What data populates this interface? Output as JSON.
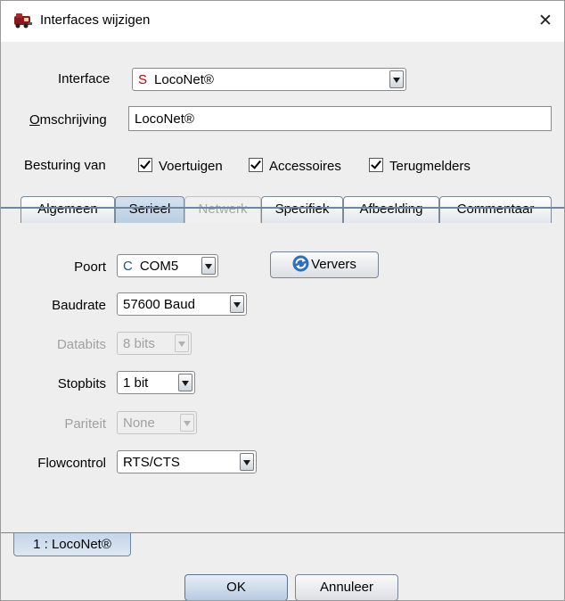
{
  "window": {
    "title": "Interfaces wijzigen",
    "close_symbol": "✕"
  },
  "interface": {
    "label": "Interface",
    "badge": "S",
    "value": "LocoNet®"
  },
  "description": {
    "label_first": "O",
    "label_rest": "mschrijving",
    "value": "LocoNet®"
  },
  "control": {
    "label": "Besturing van",
    "options": [
      {
        "label": "Voertuigen",
        "checked": true
      },
      {
        "label": "Accessoires",
        "checked": true
      },
      {
        "label": "Terugmelders",
        "checked": true
      }
    ]
  },
  "tabs": [
    {
      "label": "Algemeen",
      "state": "normal"
    },
    {
      "label": "Serieel",
      "state": "selected"
    },
    {
      "label": "Netwerk",
      "state": "disabled"
    },
    {
      "label": "Specifiek",
      "state": "normal"
    },
    {
      "label": "Afbeelding",
      "state": "normal"
    },
    {
      "label": "Commentaar",
      "state": "normal"
    }
  ],
  "serial": {
    "port": {
      "label": "Poort",
      "badge": "C",
      "value": "COM5"
    },
    "refresh_label": "Ververs",
    "baudrate": {
      "label": "Baudrate",
      "value": "57600 Baud"
    },
    "databits": {
      "label": "Databits",
      "value": "8 bits",
      "enabled": false
    },
    "stopbits": {
      "label": "Stopbits",
      "value": "1 bit"
    },
    "parity": {
      "label": "Pariteit",
      "value": "None",
      "enabled": false
    },
    "flowcontrol": {
      "label": "Flowcontrol",
      "value": "RTS/CTS"
    }
  },
  "interface_list": {
    "tab_label": "1 : LocoNet®"
  },
  "buttons": {
    "ok": "OK",
    "cancel": "Annuleer"
  },
  "colors": {
    "selected_tab": "#b9cde3",
    "separator": "#6d86a3",
    "badge_red": "#cc0000"
  }
}
